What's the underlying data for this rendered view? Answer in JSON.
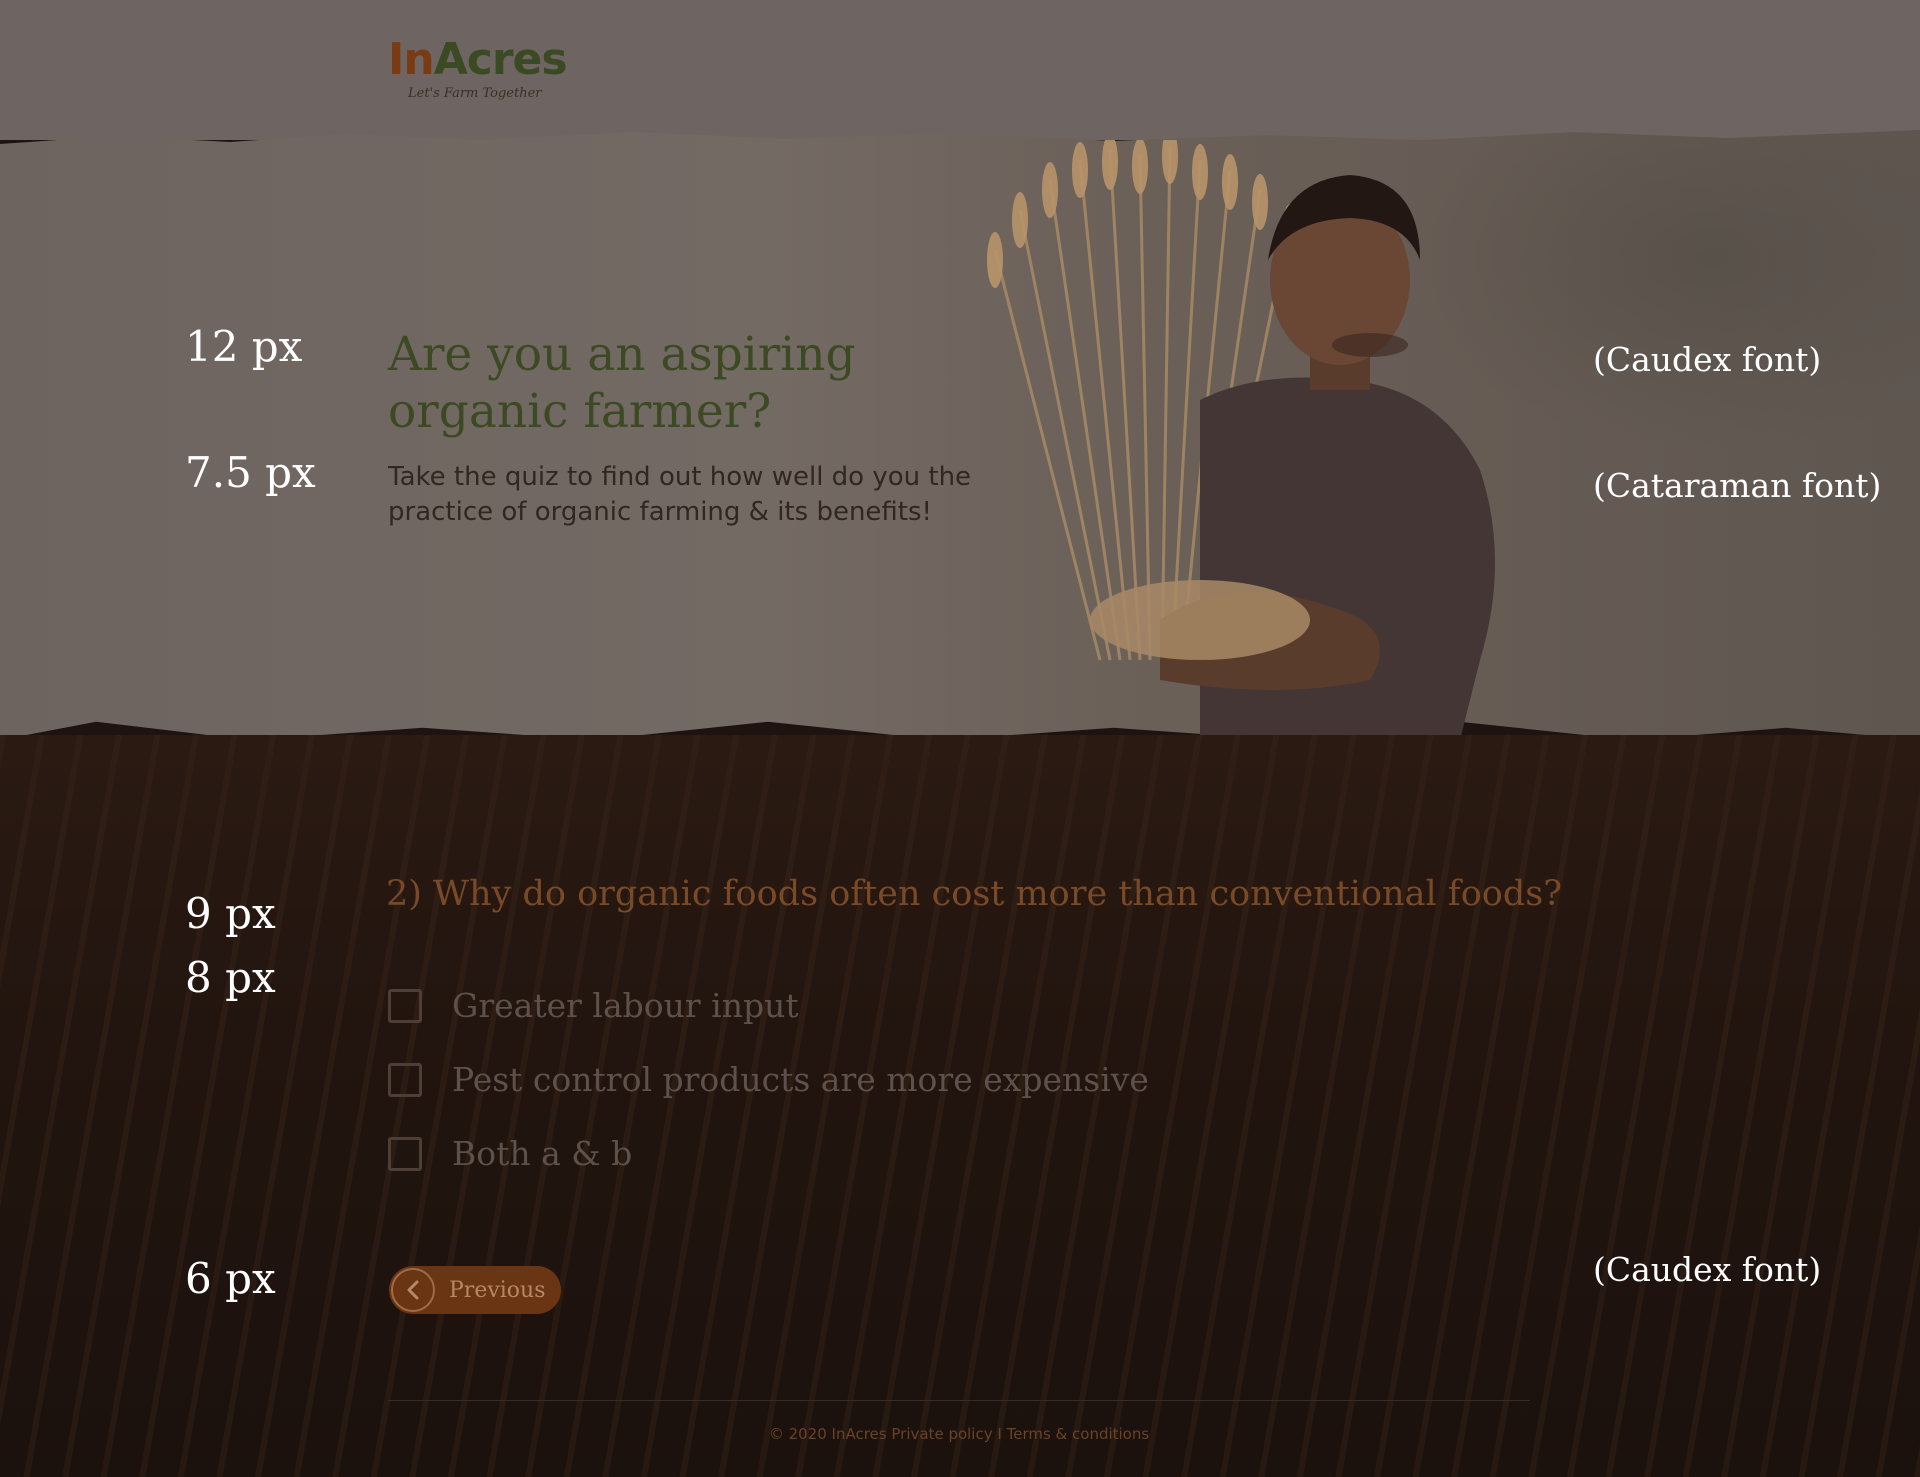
{
  "brand": {
    "logo_in": "In",
    "logo_acres": "Acres",
    "tagline": "Let's Farm Together"
  },
  "hero": {
    "title": "Are you an aspiring organic farmer?",
    "subtitle": "Take the quiz to find out how well do you the practice of organic farming & its benefits!"
  },
  "annotations": {
    "hero_title_size": "12 px",
    "hero_subtitle_size": "7.5 px",
    "question_size": "9 px",
    "option_size": "8 px",
    "button_size": "6 px",
    "hero_title_font": "(Caudex font)",
    "hero_subtitle_font": "(Cataraman font)",
    "button_font": "(Caudex font)"
  },
  "quiz": {
    "question": "2) Why do organic foods often cost more than conventional foods?",
    "options": [
      {
        "label": "Greater labour input",
        "checked": false
      },
      {
        "label": "Pest control products are more expensive",
        "checked": false
      },
      {
        "label": "Both a & b",
        "checked": false
      }
    ],
    "previous_label": "Previous"
  },
  "footer": {
    "copyright": "© 2020 InAcres",
    "privacy": "Private policy",
    "separator": "I",
    "terms": "Terms & conditions"
  },
  "colors": {
    "top_band": "#6e6562",
    "title_green": "#3c4a24",
    "question_brown": "#7a4a26",
    "button_bg": "#6a3512",
    "field_dark": "#1e1310"
  }
}
